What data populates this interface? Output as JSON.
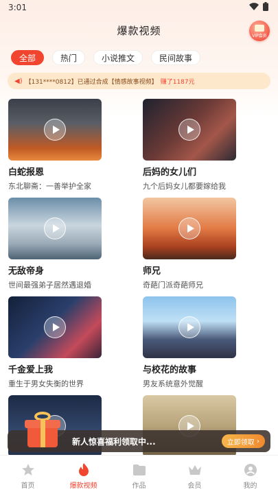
{
  "status": {
    "time": "3:01"
  },
  "header": {
    "title": "爆款视频",
    "vip_label": "VIP会员"
  },
  "tabs": [
    {
      "label": "全部",
      "active": true
    },
    {
      "label": "热门",
      "active": false
    },
    {
      "label": "小说推文",
      "active": false
    },
    {
      "label": "民间故事",
      "active": false
    }
  ],
  "notice": {
    "text": "【131****0812】已通过合成【情感故事视频】",
    "earn": "赚了1187元"
  },
  "videos": [
    {
      "title": "白蛇报恩",
      "subtitle": "东北聊斋：一善举护全家"
    },
    {
      "title": "后妈的女儿们",
      "subtitle": "九个后妈女儿都要嫁给我"
    },
    {
      "title": "无敌帝身",
      "subtitle": "世间最强弟子居然遇退婚"
    },
    {
      "title": "师兄",
      "subtitle": "奇葩门派奇葩师兄"
    },
    {
      "title": "千金爱上我",
      "subtitle": "重生于男女失衡的世界"
    },
    {
      "title": "与校花的故事",
      "subtitle": "男友系统意外觉醒"
    },
    {
      "title": "",
      "subtitle": ""
    },
    {
      "title": "",
      "subtitle": ""
    }
  ],
  "promo": {
    "text": "新人惊喜福利领取中...",
    "button": "立即领取"
  },
  "tabbar": [
    {
      "label": "首页",
      "icon": "star-icon",
      "active": false
    },
    {
      "label": "爆款视频",
      "icon": "flame-icon",
      "active": true
    },
    {
      "label": "作品",
      "icon": "folder-icon",
      "active": false
    },
    {
      "label": "会员",
      "icon": "crown-icon",
      "active": false
    },
    {
      "label": "我的",
      "icon": "profile-icon",
      "active": false
    }
  ]
}
